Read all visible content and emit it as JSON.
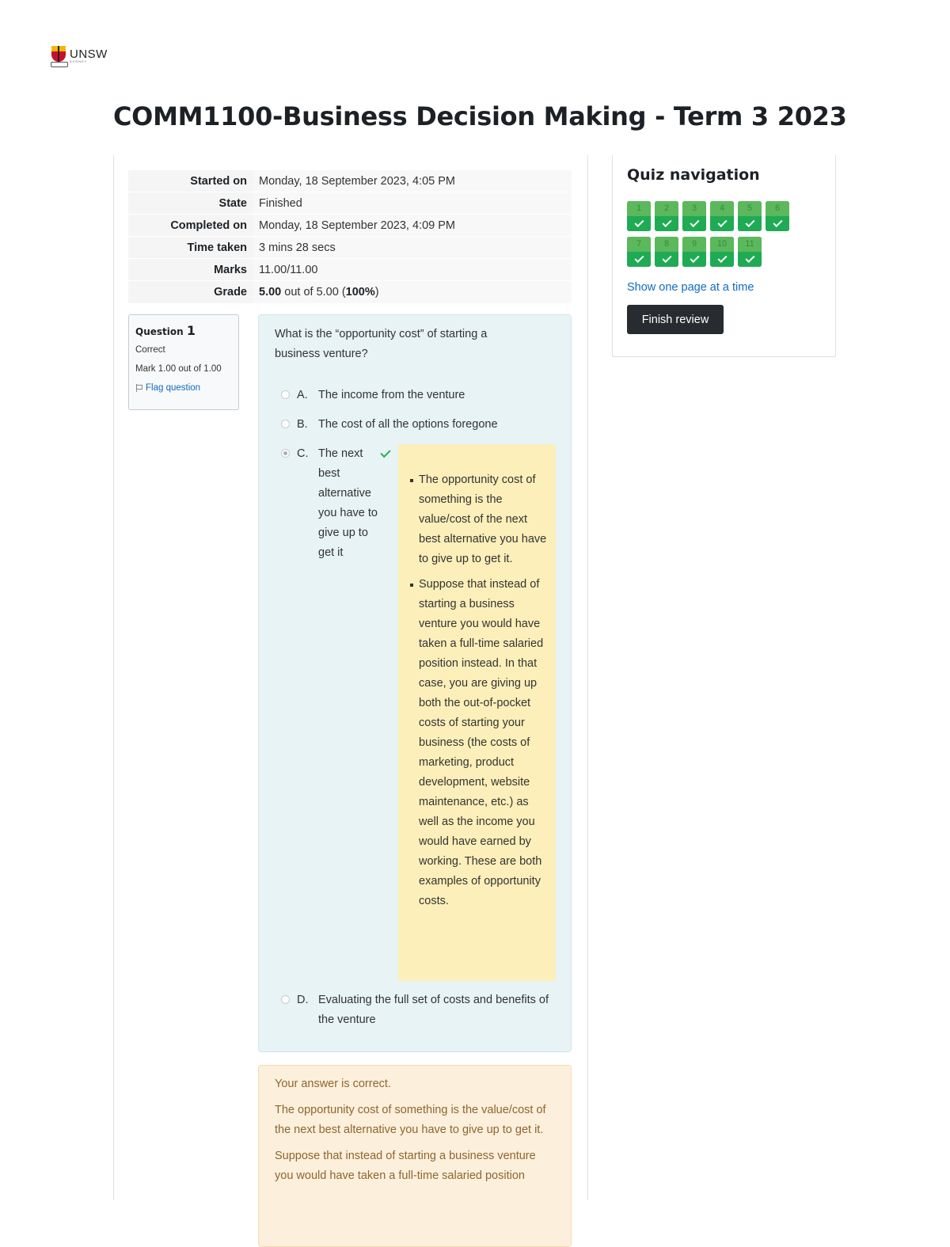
{
  "logo": {
    "text": "UNSW",
    "sub": "SYDNEY"
  },
  "page_title": "COMM1100-Business Decision Making - Term 3 2023",
  "summary": [
    {
      "label": "Started on",
      "value": "Monday, 18 September 2023, 4:05 PM"
    },
    {
      "label": "State",
      "value": "Finished"
    },
    {
      "label": "Completed on",
      "value": "Monday, 18 September 2023, 4:09 PM"
    },
    {
      "label": "Time taken",
      "value": "3 mins 28 secs"
    },
    {
      "label": "Marks",
      "value": "11.00/11.00"
    },
    {
      "label": "Grade",
      "value_bold": "5.00",
      "value_mid": " out of 5.00 (",
      "value_pct": "100%",
      "value_end": ")"
    }
  ],
  "question_info": {
    "label": "Question",
    "number": "1",
    "state": "Correct",
    "grade": "Mark 1.00 out of 1.00",
    "flag": "Flag question"
  },
  "question": {
    "text": "What is the “opportunity cost” of starting a business venture?",
    "options": [
      {
        "letter": "A.",
        "text": "The income from the venture"
      },
      {
        "letter": "B.",
        "text": "The cost of all the options foregone"
      },
      {
        "letter": "C.",
        "text": "The next best alternative you have to give up to get it"
      },
      {
        "letter": "D.",
        "text": "Evaluating the full set of costs and benefits of the venture"
      }
    ],
    "selected": "C",
    "feedback": [
      "The opportunity cost of something is the value/cost of the next best alternative you have to give up to get it.",
      "Suppose that instead of starting a business venture you would have taken a full-time salaried position instead. In that case, you are giving up both the out-of-pocket costs of starting your business (the costs of marketing, product development, website maintenance, etc.) as well as the income you would have earned by working. These are both examples of opportunity costs."
    ]
  },
  "outcome": {
    "correct": "Your answer is correct.",
    "p1": "The opportunity cost of something is the value/cost of the next best alternative you have to give up to get it.",
    "p2": "Suppose that instead of starting a business venture you would have taken a full-time salaried position"
  },
  "quiz_nav": {
    "title": "Quiz navigation",
    "buttons": [
      "1",
      "2",
      "3",
      "4",
      "5",
      "6",
      "7",
      "8",
      "9",
      "10",
      "11"
    ],
    "show_one_page": "Show one page at a time",
    "finish_review": "Finish review"
  },
  "colors": {
    "nav_correct": "#1fab54",
    "link": "#0f6cbf",
    "question_bg": "#e7f3f5",
    "feedback_bg": "#fcefb9",
    "outcome_bg": "#fcefdc"
  }
}
